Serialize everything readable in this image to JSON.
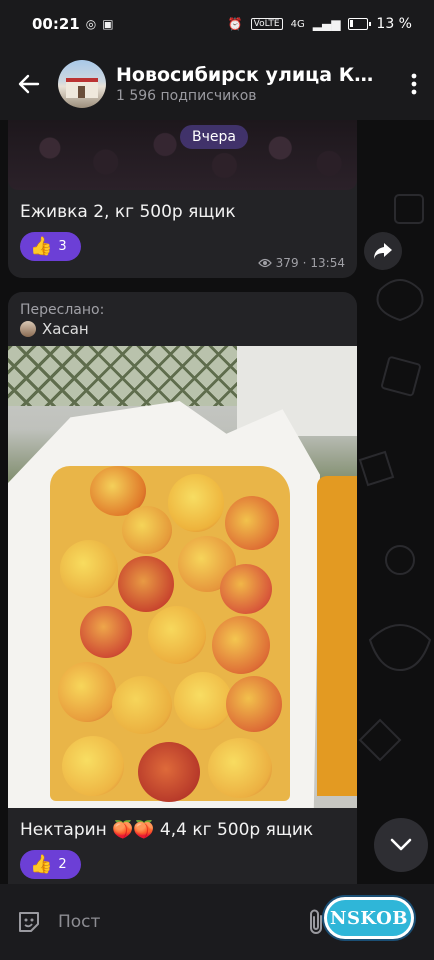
{
  "status_bar": {
    "time": "00:21",
    "battery": "13 %",
    "network_label": "VoLTE",
    "signal_label": "4G"
  },
  "header": {
    "title": "Новосибирск улица  Ка...",
    "subtitle": "1 596 подписчиков"
  },
  "date_separator": "Вчера",
  "posts": [
    {
      "text": "Еживка 2, кг 500р ящик",
      "reaction_emoji": "👍",
      "reaction_count": "3",
      "views": "379",
      "time": "13:54"
    },
    {
      "forwarded_label": "Переслано:",
      "forwarded_from": "Хасан",
      "text": "Нектарин 🍑🍑 4,4 кг 500р ящик",
      "reaction_emoji": "👍",
      "reaction_count": "2"
    }
  ],
  "composer": {
    "placeholder": "Пост"
  },
  "watermark": "NSKOB",
  "colors": {
    "accent": "#6c3fd6",
    "background": "#0f0f10",
    "card": "#232326"
  }
}
